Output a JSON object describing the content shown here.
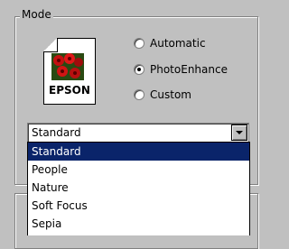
{
  "group": {
    "label": "Mode"
  },
  "logo": {
    "brand": "EPSON"
  },
  "modes": [
    {
      "label": "Automatic",
      "checked": false
    },
    {
      "label": "PhotoEnhance",
      "checked": true
    },
    {
      "label": "Custom",
      "checked": false
    }
  ],
  "combo": {
    "value": "Standard"
  },
  "dropdown": {
    "items": [
      "Standard",
      "People",
      "Nature",
      "Soft Focus",
      "Sepia"
    ],
    "selected": "Standard"
  },
  "colors": {
    "selection": "#0a246a",
    "panel": "#c0c0c0"
  }
}
